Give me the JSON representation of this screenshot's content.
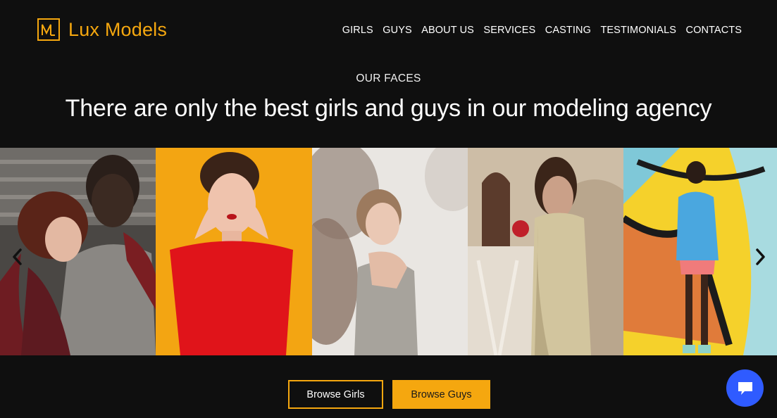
{
  "brand": {
    "logo_mark": "M",
    "name": "Lux Models",
    "accent": "#f5a70f"
  },
  "nav": {
    "items": [
      {
        "label": "GIRLS"
      },
      {
        "label": "GUYS"
      },
      {
        "label": "ABOUT US"
      },
      {
        "label": "SERVICES"
      },
      {
        "label": "CASTING"
      },
      {
        "label": "TESTIMONIALS"
      },
      {
        "label": "CONTACTS"
      }
    ]
  },
  "section": {
    "eyebrow": "OUR FACES",
    "headline": "There are only the best girls and guys in our modeling agency"
  },
  "carousel": {
    "prev_icon": "chevron-left-icon",
    "next_icon": "chevron-right-icon"
  },
  "buttons": {
    "browse_girls": "Browse Girls",
    "browse_guys": "Browse Guys"
  },
  "chat": {
    "icon": "chat-bubble-icon",
    "color": "#2f5bff"
  }
}
